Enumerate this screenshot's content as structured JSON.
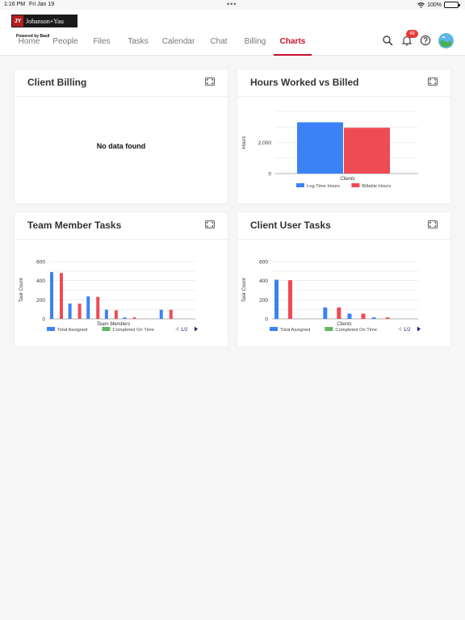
{
  "status_bar": {
    "time": "1:16 PM",
    "date": "Fri Jan 19",
    "battery": "100%"
  },
  "app": {
    "logo_text": "Johanson+Yau",
    "powered_by": "Powered by Basil"
  },
  "nav": {
    "tabs": [
      {
        "id": "home",
        "label": "Home",
        "active": false
      },
      {
        "id": "people",
        "label": "People",
        "active": false
      },
      {
        "id": "files",
        "label": "Files",
        "active": false
      },
      {
        "id": "tasks",
        "label": "Tasks",
        "active": false
      },
      {
        "id": "calendar",
        "label": "Calendar",
        "active": false
      },
      {
        "id": "chat",
        "label": "Chat",
        "active": false
      },
      {
        "id": "billing",
        "label": "Billing",
        "active": false
      },
      {
        "id": "charts",
        "label": "Charts",
        "active": true
      }
    ]
  },
  "header_actions": {
    "notification_count": "48",
    "icons": [
      "search-icon",
      "bell-icon",
      "help-icon",
      "avatar"
    ]
  },
  "colors": {
    "accent": "#c8102e",
    "blue": "#3b82f6",
    "red": "#ef4b55",
    "green": "#5cb85c"
  },
  "cards": {
    "client_billing": {
      "title": "Client Billing",
      "empty_text": "No data found"
    },
    "hours": {
      "title": "Hours Worked vs Billed"
    },
    "team_tasks": {
      "title": "Team Member Tasks"
    },
    "client_tasks": {
      "title": "Client User Tasks"
    }
  },
  "chart_data": [
    {
      "id": "hours",
      "type": "bar",
      "xlabel": "Clients",
      "ylabel": "Hours",
      "yticks": [
        "0",
        "2,000"
      ],
      "ylim": [
        0,
        4000
      ],
      "grid": true,
      "legend_position": "bottom",
      "categories": [
        ""
      ],
      "series": [
        {
          "name": "Log Time Hours",
          "color": "#3b82f6",
          "values": [
            3300
          ]
        },
        {
          "name": "Billable Hours",
          "color": "#ef4b55",
          "values": [
            2950
          ]
        }
      ]
    },
    {
      "id": "team",
      "type": "bar",
      "xlabel": "Team Members",
      "ylabel": "Task Count",
      "yticks": [
        "0",
        "200",
        "400",
        "600"
      ],
      "ylim": [
        0,
        600
      ],
      "grid": true,
      "legend_position": "bottom",
      "categories": [
        "",
        "",
        "",
        "",
        "",
        "",
        "",
        ""
      ],
      "series": [
        {
          "name": "Total Assigned",
          "color": "#3b82f6",
          "values": [
            490,
            160,
            235,
            95,
            15,
            0,
            95,
            0
          ]
        },
        {
          "name": "Completed On Time",
          "color": "#5cb85c",
          "values": [
            0,
            0,
            0,
            0,
            0,
            0,
            0,
            0
          ]
        },
        {
          "name": "",
          "color": "#ef4b55",
          "values": [
            480,
            160,
            230,
            90,
            15,
            0,
            95,
            0
          ]
        }
      ],
      "pager": "1/2"
    },
    {
      "id": "client",
      "type": "bar",
      "xlabel": "Clients",
      "ylabel": "Task Count",
      "yticks": [
        "0",
        "200",
        "400",
        "600"
      ],
      "ylim": [
        0,
        600
      ],
      "grid": true,
      "legend_position": "bottom",
      "categories": [
        "",
        "",
        "",
        "",
        "",
        ""
      ],
      "series": [
        {
          "name": "Total Assigned",
          "color": "#3b82f6",
          "values": [
            410,
            0,
            120,
            55,
            15,
            0
          ]
        },
        {
          "name": "Completed On Time",
          "color": "#5cb85c",
          "values": [
            0,
            0,
            0,
            0,
            0,
            0
          ]
        },
        {
          "name": "",
          "color": "#ef4b55",
          "values": [
            405,
            0,
            120,
            55,
            15,
            0
          ]
        }
      ],
      "pager": "1/2"
    }
  ]
}
